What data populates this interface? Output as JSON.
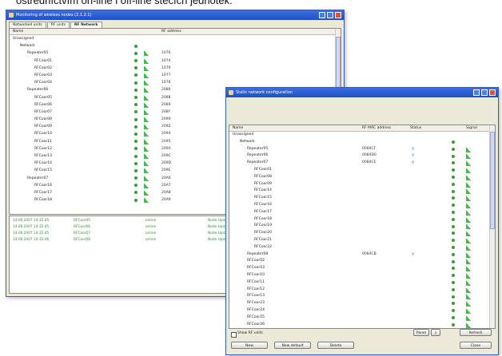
{
  "caption": "ostredníctvím on-line i off-line stečích jednotek.",
  "monitor": {
    "title": "Monitoring of wireless nodes (2.1.2.1)",
    "tabs": [
      "Networked units",
      "RF units",
      "RF Network"
    ],
    "col_name": "Name",
    "col_rf": "RF address",
    "tree": [
      {
        "indent": 0,
        "label": "Unassigned",
        "dot": false,
        "sig": false,
        "rf": ""
      },
      {
        "indent": 1,
        "label": "Network",
        "dot": true,
        "sig": false,
        "rf": ""
      },
      {
        "indent": 2,
        "label": "Repeater05",
        "dot": true,
        "sig": true,
        "rf": "1076"
      },
      {
        "indent": 3,
        "label": "RFCoor01",
        "dot": true,
        "sig": true,
        "rf": "1074"
      },
      {
        "indent": 3,
        "label": "RFCoor02",
        "dot": true,
        "sig": true,
        "rf": "1076"
      },
      {
        "indent": 3,
        "label": "RFCoor03",
        "dot": true,
        "sig": true,
        "rf": "1077"
      },
      {
        "indent": 3,
        "label": "RFCoor04",
        "dot": true,
        "sig": true,
        "rf": "1078"
      },
      {
        "indent": 2,
        "label": "Repeater06",
        "dot": true,
        "sig": true,
        "rf": "2086"
      },
      {
        "indent": 3,
        "label": "RFCoor05",
        "dot": true,
        "sig": true,
        "rf": "2088"
      },
      {
        "indent": 3,
        "label": "RFCoor06",
        "dot": true,
        "sig": true,
        "rf": "2089"
      },
      {
        "indent": 3,
        "label": "RFCoor07",
        "dot": true,
        "sig": true,
        "rf": "208F"
      },
      {
        "indent": 3,
        "label": "RFCoor08",
        "dot": true,
        "sig": true,
        "rf": "2090"
      },
      {
        "indent": 3,
        "label": "RFCoor09",
        "dot": true,
        "sig": true,
        "rf": "2092"
      },
      {
        "indent": 3,
        "label": "RFCoor10",
        "dot": true,
        "sig": true,
        "rf": "2094"
      },
      {
        "indent": 3,
        "label": "RFCoor11",
        "dot": true,
        "sig": true,
        "rf": "2095"
      },
      {
        "indent": 3,
        "label": "RFCoor12",
        "dot": true,
        "sig": true,
        "rf": "209A"
      },
      {
        "indent": 3,
        "label": "RFCoor13",
        "dot": true,
        "sig": true,
        "rf": "209C"
      },
      {
        "indent": 3,
        "label": "RFCoor14",
        "dot": true,
        "sig": true,
        "rf": "209D"
      },
      {
        "indent": 3,
        "label": "RFCoor15",
        "dot": true,
        "sig": true,
        "rf": "209E"
      },
      {
        "indent": 2,
        "label": "Repeater07",
        "dot": true,
        "sig": true,
        "rf": "20A6"
      },
      {
        "indent": 3,
        "label": "RFCoor16",
        "dot": true,
        "sig": true,
        "rf": "20A7"
      },
      {
        "indent": 3,
        "label": "RFCoor17",
        "dot": true,
        "sig": true,
        "rf": "20A8"
      },
      {
        "indent": 3,
        "label": "RFCoor18",
        "dot": true,
        "sig": true,
        "rf": "20A9"
      }
    ],
    "log": [
      {
        "time": "14.06.2007 14:32:45",
        "node": "RFCoor05",
        "state": "online",
        "msg": "Node Updated"
      },
      {
        "time": "14.06.2007 14:32:45",
        "node": "RFCoor06",
        "state": "online",
        "msg": "Node Updated"
      },
      {
        "time": "14.06.2007 14:32:45",
        "node": "RFCoor07",
        "state": "online",
        "msg": "Node Updated"
      },
      {
        "time": "14.06.2007 14:32:46",
        "node": "RFCoor08",
        "state": "online",
        "msg": "Node Updated"
      }
    ]
  },
  "config": {
    "title": "Static network configuration",
    "col_name": "Name",
    "col_mac": "RF MAC address",
    "col_status": "Status",
    "col_signal": "Signal",
    "tree": [
      {
        "indent": 0,
        "label": "Unassigned",
        "mac": "",
        "status": false,
        "dot": false,
        "sig": false
      },
      {
        "indent": 1,
        "label": "Network",
        "mac": "",
        "status": false,
        "dot": true,
        "sig": false
      },
      {
        "indent": 2,
        "label": "Repeater05",
        "mac": "0084CF",
        "status": true,
        "dot": true,
        "sig": true
      },
      {
        "indent": 2,
        "label": "Repeater06",
        "mac": "0084D0",
        "status": true,
        "dot": true,
        "sig": true
      },
      {
        "indent": 2,
        "label": "Repeater07",
        "mac": "0084CE",
        "status": true,
        "dot": true,
        "sig": true
      },
      {
        "indent": 3,
        "label": "RFCoor01",
        "mac": "",
        "status": false,
        "dot": true,
        "sig": true
      },
      {
        "indent": 3,
        "label": "RFCoor08",
        "mac": "",
        "status": false,
        "dot": true,
        "sig": true
      },
      {
        "indent": 3,
        "label": "RFCoor09",
        "mac": "",
        "status": false,
        "dot": true,
        "sig": true
      },
      {
        "indent": 3,
        "label": "RFCoor14",
        "mac": "",
        "status": false,
        "dot": true,
        "sig": true
      },
      {
        "indent": 3,
        "label": "RFCoor15",
        "mac": "",
        "status": false,
        "dot": true,
        "sig": true
      },
      {
        "indent": 3,
        "label": "RFCoor16",
        "mac": "",
        "status": false,
        "dot": true,
        "sig": true
      },
      {
        "indent": 3,
        "label": "RFCoor17",
        "mac": "",
        "status": false,
        "dot": true,
        "sig": true
      },
      {
        "indent": 3,
        "label": "RFCoor18",
        "mac": "",
        "status": false,
        "dot": true,
        "sig": true
      },
      {
        "indent": 3,
        "label": "RFCoor19",
        "mac": "",
        "status": false,
        "dot": true,
        "sig": true
      },
      {
        "indent": 3,
        "label": "RFCoor20",
        "mac": "",
        "status": false,
        "dot": true,
        "sig": true
      },
      {
        "indent": 3,
        "label": "RFCoor21",
        "mac": "",
        "status": false,
        "dot": true,
        "sig": true
      },
      {
        "indent": 3,
        "label": "RFCoor22",
        "mac": "",
        "status": false,
        "dot": true,
        "sig": true
      },
      {
        "indent": 2,
        "label": "Repeater08",
        "mac": "0084CB",
        "status": true,
        "dot": true,
        "sig": true
      },
      {
        "indent": 2,
        "label": "RFCoor02",
        "mac": "",
        "status": false,
        "dot": true,
        "sig": true
      },
      {
        "indent": 2,
        "label": "RFCoor03",
        "mac": "",
        "status": false,
        "dot": true,
        "sig": true
      },
      {
        "indent": 2,
        "label": "RFCoor10",
        "mac": "",
        "status": false,
        "dot": true,
        "sig": true
      },
      {
        "indent": 2,
        "label": "RFCoor11",
        "mac": "",
        "status": false,
        "dot": true,
        "sig": true
      },
      {
        "indent": 2,
        "label": "RFCoor12",
        "mac": "",
        "status": false,
        "dot": true,
        "sig": true
      },
      {
        "indent": 2,
        "label": "RFCoor13",
        "mac": "",
        "status": false,
        "dot": true,
        "sig": true
      },
      {
        "indent": 2,
        "label": "RFCoor23",
        "mac": "",
        "status": false,
        "dot": true,
        "sig": true
      },
      {
        "indent": 2,
        "label": "RFCoor24",
        "mac": "",
        "status": false,
        "dot": true,
        "sig": true
      },
      {
        "indent": 2,
        "label": "RFCoor25",
        "mac": "",
        "status": false,
        "dot": true,
        "sig": true
      },
      {
        "indent": 2,
        "label": "RFCoor26",
        "mac": "",
        "status": false,
        "dot": true,
        "sig": true
      }
    ],
    "show_rf_units": "Show RF units",
    "btn_new": "New",
    "btn_newdefault": "New default",
    "btn_delete": "Delete",
    "btn_panel": "Panel",
    "btn_refresh": "Refresh",
    "btn_close": "Close"
  }
}
